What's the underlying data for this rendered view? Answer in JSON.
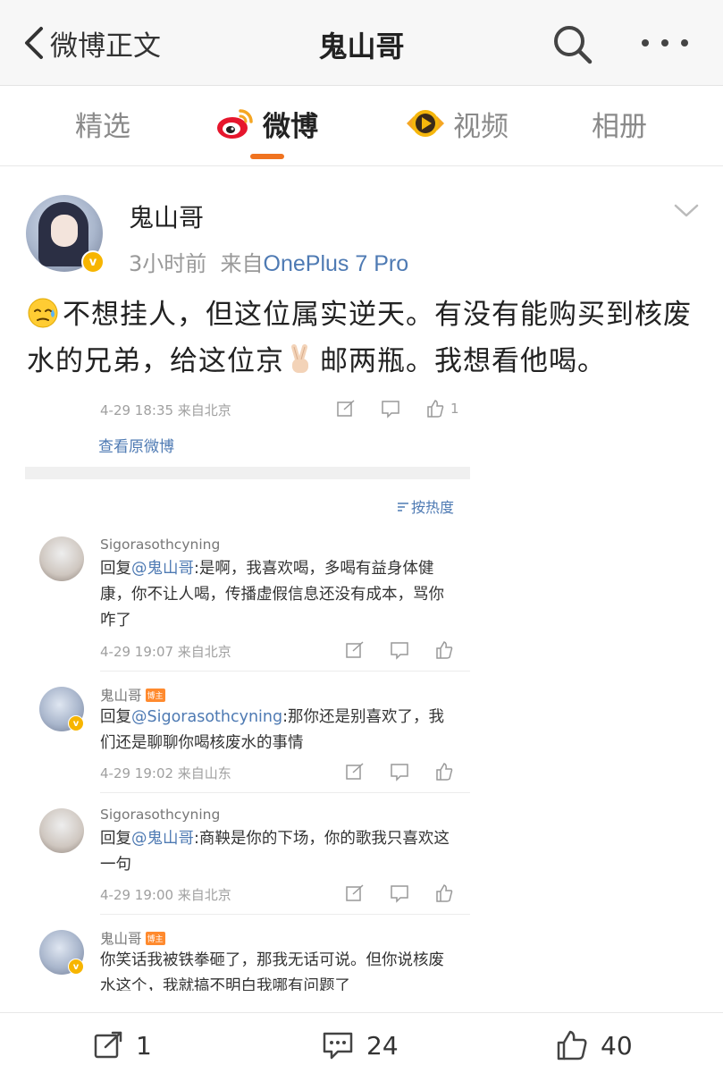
{
  "nav": {
    "back_label": "微博正文",
    "title": "鬼山哥"
  },
  "tabs": [
    {
      "label": "精选",
      "icon": "none"
    },
    {
      "label": "微博",
      "icon": "weibo-logo-icon",
      "active": true
    },
    {
      "label": "视频",
      "icon": "video-badge-icon"
    },
    {
      "label": "相册",
      "icon": "none"
    }
  ],
  "post": {
    "author": "鬼山哥",
    "time": "3小时前",
    "from_prefix": "来自",
    "source": "OnePlus 7 Pro",
    "text_part1": "不想挂人，但这位属实逆天。有没有能购买到核废水的兄弟，给这位京",
    "text_part2": "邮两瓶。我想看他喝。",
    "emoji1": "sweat-emoji",
    "emoji2": "victory-hand-emoji"
  },
  "screenshot": {
    "orig_meta": "4-29 18:35  来自北京",
    "orig_like_count": "1",
    "view_original": "查看原微博",
    "sort_label": "按热度",
    "comments": [
      {
        "name": "Sigorasothcyning",
        "reply_prefix": "回复",
        "at": "@鬼山哥",
        "text": ":是啊，我喜欢喝，多喝有益身体健康，你不让人喝，传播虚假信息还没有成本，骂你咋了",
        "meta": "4-29 19:07  来自北京"
      },
      {
        "name": "鬼山哥",
        "badge": "博主",
        "reply_prefix": "回复",
        "at": "@Sigorasothcyning",
        "text": ":那你还是别喜欢了，我们还是聊聊你喝核废水的事情",
        "meta": "4-29 19:02  来自山东"
      },
      {
        "name": "Sigorasothcyning",
        "reply_prefix": "回复",
        "at": "@鬼山哥",
        "text": ":商鞅是你的下场，你的歌我只喜欢这一句",
        "meta": "4-29 19:00  来自北京"
      },
      {
        "name": "鬼山哥",
        "badge": "博主",
        "text": "你笑话我被铁拳砸了，那我无话可说。但你说核废水这个，我就搞不明白我哪有问题了"
      }
    ]
  },
  "actions": {
    "repost_count": "1",
    "comment_count": "24",
    "like_count": "40"
  },
  "colors": {
    "accent_orange": "#f07320",
    "link_blue": "#4e7ab3",
    "verified_gold": "#f7b500"
  }
}
